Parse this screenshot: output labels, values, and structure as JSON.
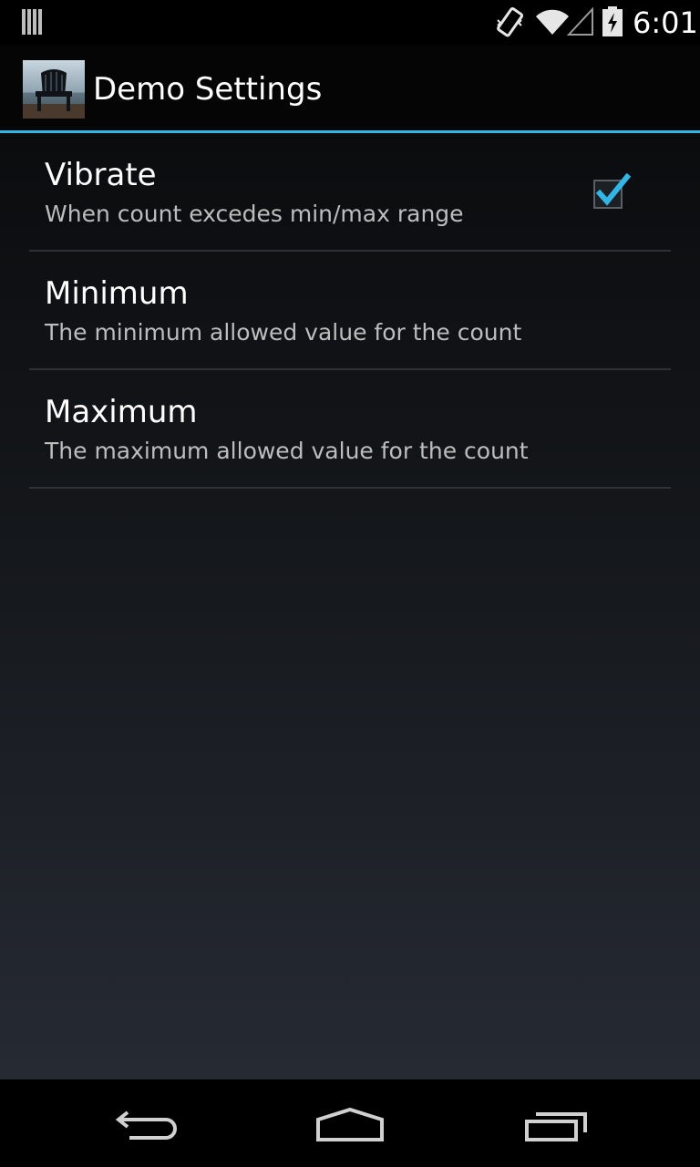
{
  "status_bar": {
    "time": "6:01",
    "icons": [
      "notification-bars-icon",
      "vibrate-icon",
      "wifi-icon",
      "no-signal-icon",
      "battery-charging-icon"
    ]
  },
  "action_bar": {
    "title": "Demo Settings",
    "icon": "app-chair-icon"
  },
  "preferences": [
    {
      "title": "Vibrate",
      "summary": "When count excedes min/max range",
      "checked": true
    },
    {
      "title": "Minimum",
      "summary": "The minimum allowed value for the count"
    },
    {
      "title": "Maximum",
      "summary": "The maximum allowed value for the count"
    }
  ],
  "nav_bar": {
    "buttons": [
      "back-icon",
      "home-icon",
      "recents-icon"
    ]
  },
  "colors": {
    "accent": "#33b5e5",
    "background": "#000000",
    "text_primary": "#ffffff",
    "text_secondary": "#bdbdbd"
  }
}
